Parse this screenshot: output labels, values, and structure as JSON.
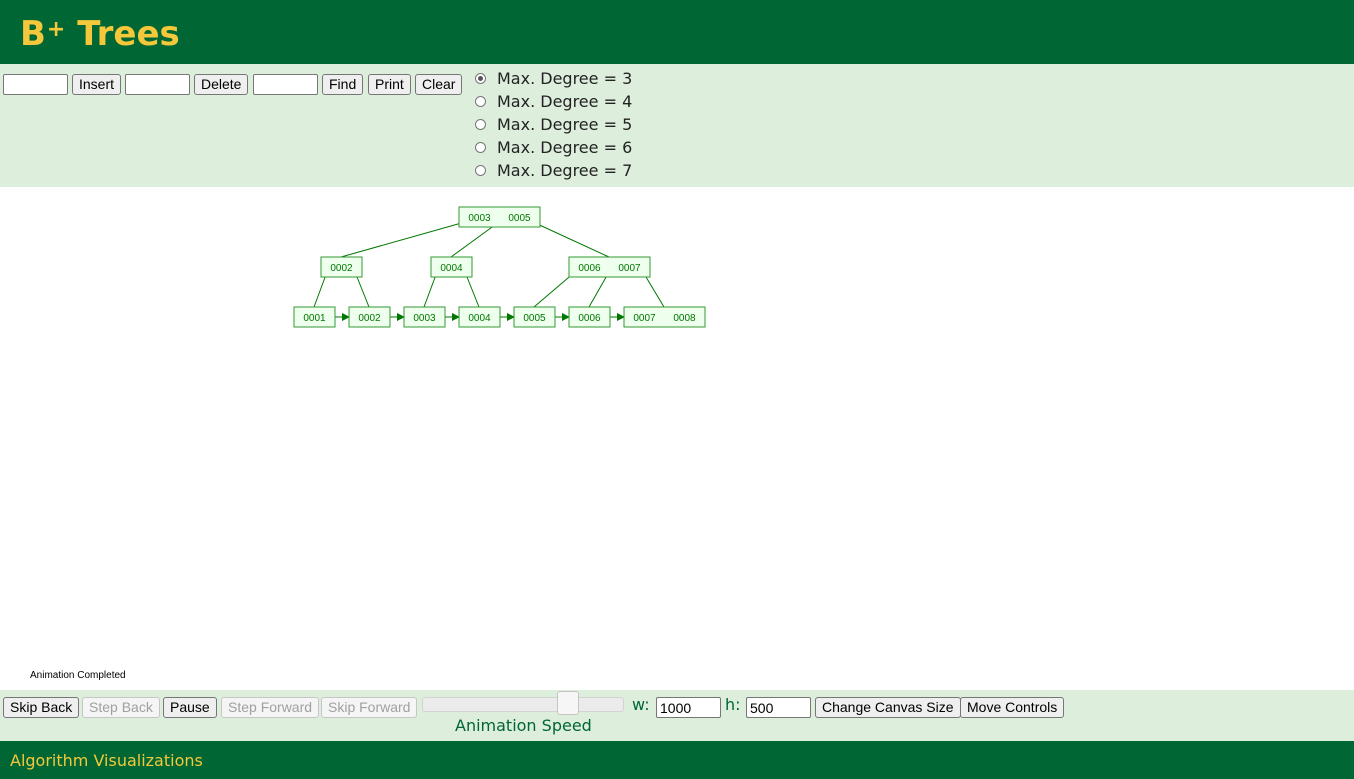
{
  "header": {
    "title": "B",
    "title_sup": "+",
    "title_rest": " Trees"
  },
  "controls": {
    "insert_value": "",
    "insert_label": "Insert",
    "delete_value": "",
    "delete_label": "Delete",
    "find_value": "",
    "find_label": "Find",
    "print_label": "Print",
    "clear_label": "Clear",
    "degree_options": [
      {
        "label": "Max. Degree = 3",
        "checked": true
      },
      {
        "label": "Max. Degree = 4",
        "checked": false
      },
      {
        "label": "Max. Degree = 5",
        "checked": false
      },
      {
        "label": "Max. Degree = 6",
        "checked": false
      },
      {
        "label": "Max. Degree = 7",
        "checked": false
      }
    ]
  },
  "tree": {
    "root": [
      "0003",
      "0005"
    ],
    "internal": [
      [
        "0002"
      ],
      [
        "0004"
      ],
      [
        "0006",
        "0007"
      ]
    ],
    "leaves": [
      [
        "0001"
      ],
      [
        "0002"
      ],
      [
        "0003"
      ],
      [
        "0004"
      ],
      [
        "0005"
      ],
      [
        "0006"
      ],
      [
        "0007",
        "0008"
      ]
    ]
  },
  "status": "Animation Completed",
  "animation": {
    "skip_back": "Skip Back",
    "step_back": "Step Back",
    "pause": "Pause",
    "step_forward": "Step Forward",
    "skip_forward": "Skip Forward",
    "speed_label": "Animation Speed",
    "speed_fraction": 0.75,
    "w_label": "w:",
    "w_value": "1000",
    "h_label": "h:",
    "h_value": "500",
    "change_canvas": "Change Canvas Size",
    "move_controls": "Move Controls"
  },
  "colors": {
    "header_bg": "#006633",
    "title": "#f5c83b",
    "panel_bg": "#ddeedd",
    "node_fill": "#eeffee",
    "node_stroke": "#339933",
    "edge": "#007700"
  },
  "footer": {
    "label": "Algorithm Visualizations"
  }
}
